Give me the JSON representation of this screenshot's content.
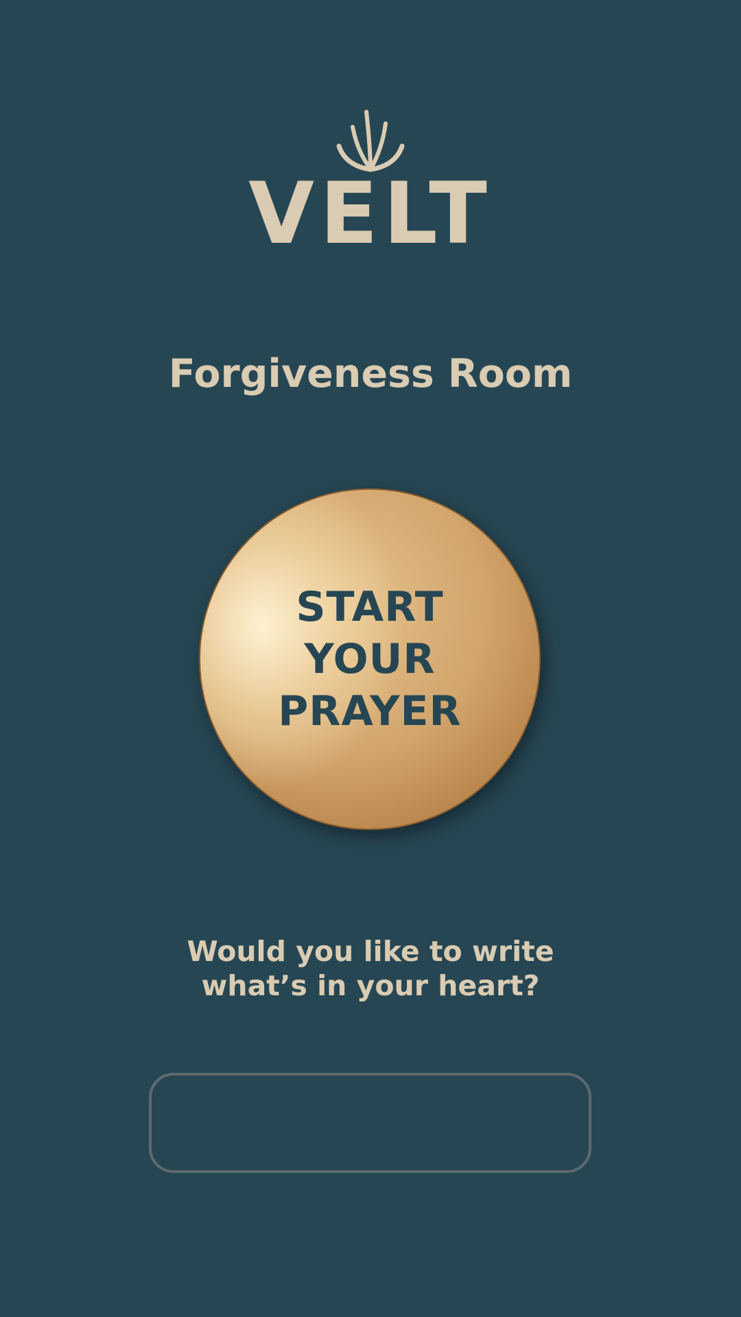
{
  "brand": {
    "logo_icon": "sprout-icon",
    "name": "VELT"
  },
  "page": {
    "title": "Forgiveness Room"
  },
  "prayer_button": {
    "label": "START\nYOUR\nPRAYER"
  },
  "prompt": {
    "text": "Would you like to write\nwhat’s in your heart?"
  },
  "heart_input": {
    "value": "",
    "placeholder": ""
  },
  "colors": {
    "background": "#274653",
    "accent_text": "#d9ccb3",
    "button_gold": "#d2a56c",
    "input_border": "#5d6a71"
  }
}
